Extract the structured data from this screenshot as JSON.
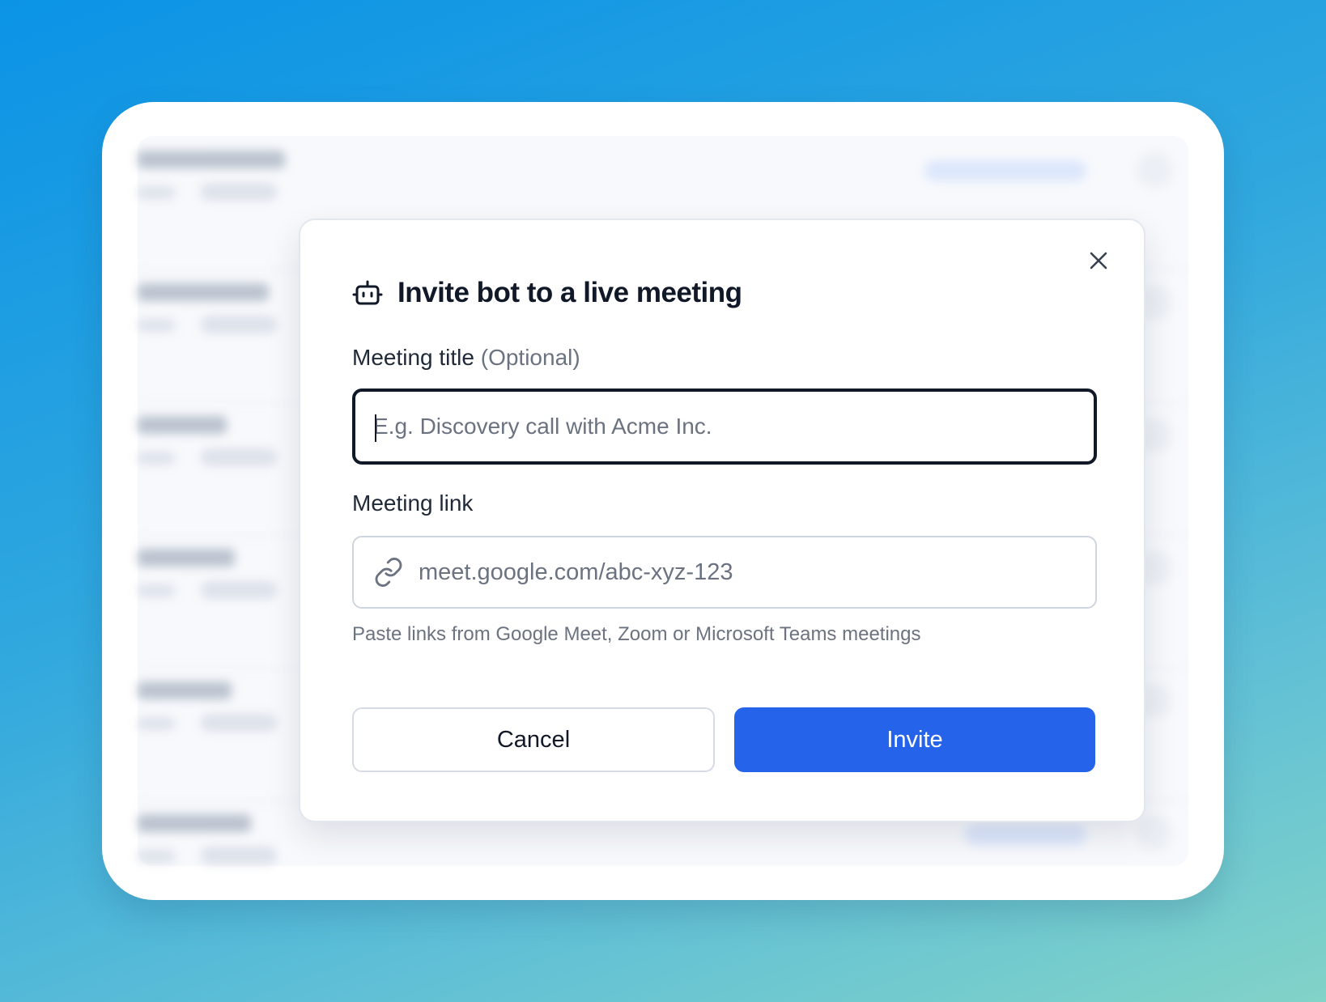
{
  "modal": {
    "title": "Invite bot to a live meeting",
    "close_icon": "close-icon",
    "title_icon": "bot-icon",
    "meeting_title": {
      "label": "Meeting title",
      "optional_hint": "(Optional)",
      "placeholder": "E.g. Discovery call with Acme Inc.",
      "value": ""
    },
    "meeting_link": {
      "label": "Meeting link",
      "icon": "link-icon",
      "placeholder": "meet.google.com/abc-xyz-123",
      "value": "",
      "helper": "Paste links from Google Meet, Zoom or Microsoft Teams meetings"
    },
    "buttons": {
      "cancel": "Cancel",
      "invite": "Invite"
    }
  },
  "colors": {
    "primary": "#2563eb",
    "text": "#111827",
    "muted": "#6b7280",
    "border": "#d7dce4"
  }
}
